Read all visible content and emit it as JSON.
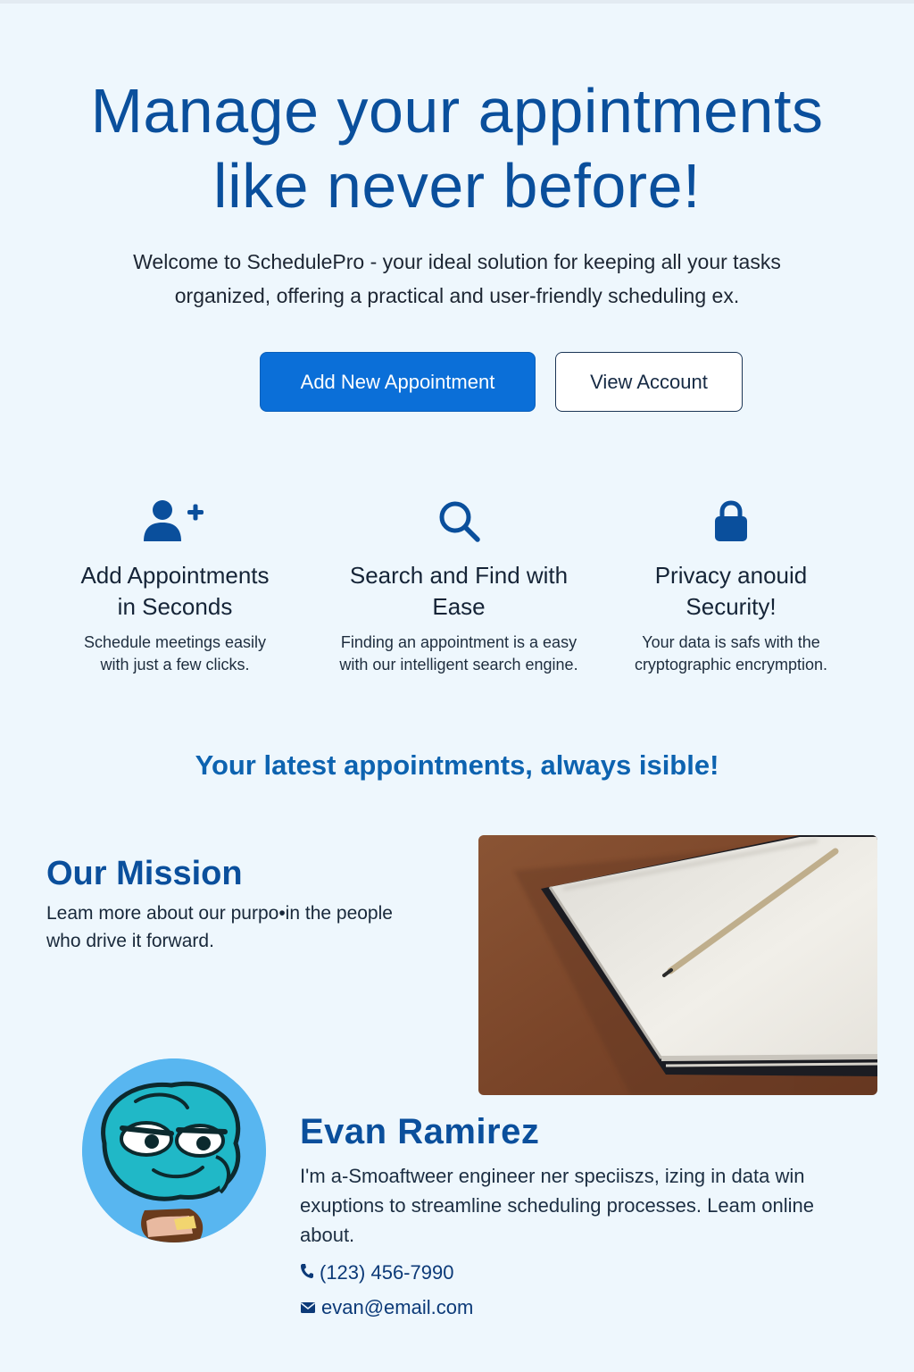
{
  "hero": {
    "title_line1": "Manage your appintments",
    "title_line2": "like never before!",
    "subtitle_line1": "Welcome to SchedulePro - your ideal solution for keeping all your tasks",
    "subtitle_line2": "organized, offering a practical and user-friendly scheduling ex."
  },
  "actions": {
    "add_label": "Add New Appointment",
    "view_label": "View Account"
  },
  "features": [
    {
      "icon": "user-plus-icon",
      "title_line1": "Add Appointments",
      "title_line2": "in Seconds",
      "text_line1": "Schedule meetings easily",
      "text_line2": "with just a few clicks."
    },
    {
      "icon": "search-icon",
      "title_line1": "Search and Find with",
      "title_line2": "Ease",
      "text_line1": "Finding an appointment is a easy",
      "text_line2": "with our intelligent search engine."
    },
    {
      "icon": "lock-icon",
      "title_line1": "Privacy anouid",
      "title_line2": "Security!",
      "text_line1": "Your data is safs with the",
      "text_line2": "cryptographic encrymption."
    }
  ],
  "latest_heading": "Your latest appointments, always isible!",
  "mission": {
    "title": "Our Mission",
    "text_line1": "Leam more about our purpo•in the people",
    "text_line2": "who drive it forward."
  },
  "person": {
    "name": "Evan Ramirez",
    "bio_line1": "I'm a-Smoaftweer engineer ner speciiszs, izing in data win",
    "bio_line2": "exuptions to streamline scheduling processes. Leam online",
    "bio_line3": "about.",
    "phone": "(123) 456-7990",
    "email": "evan@email.com"
  },
  "colors": {
    "background": "#eef7fd",
    "brand_blue": "#0a4f9c",
    "accent_blue": "#0b6fd8",
    "heading_blue": "#0d63b0"
  }
}
